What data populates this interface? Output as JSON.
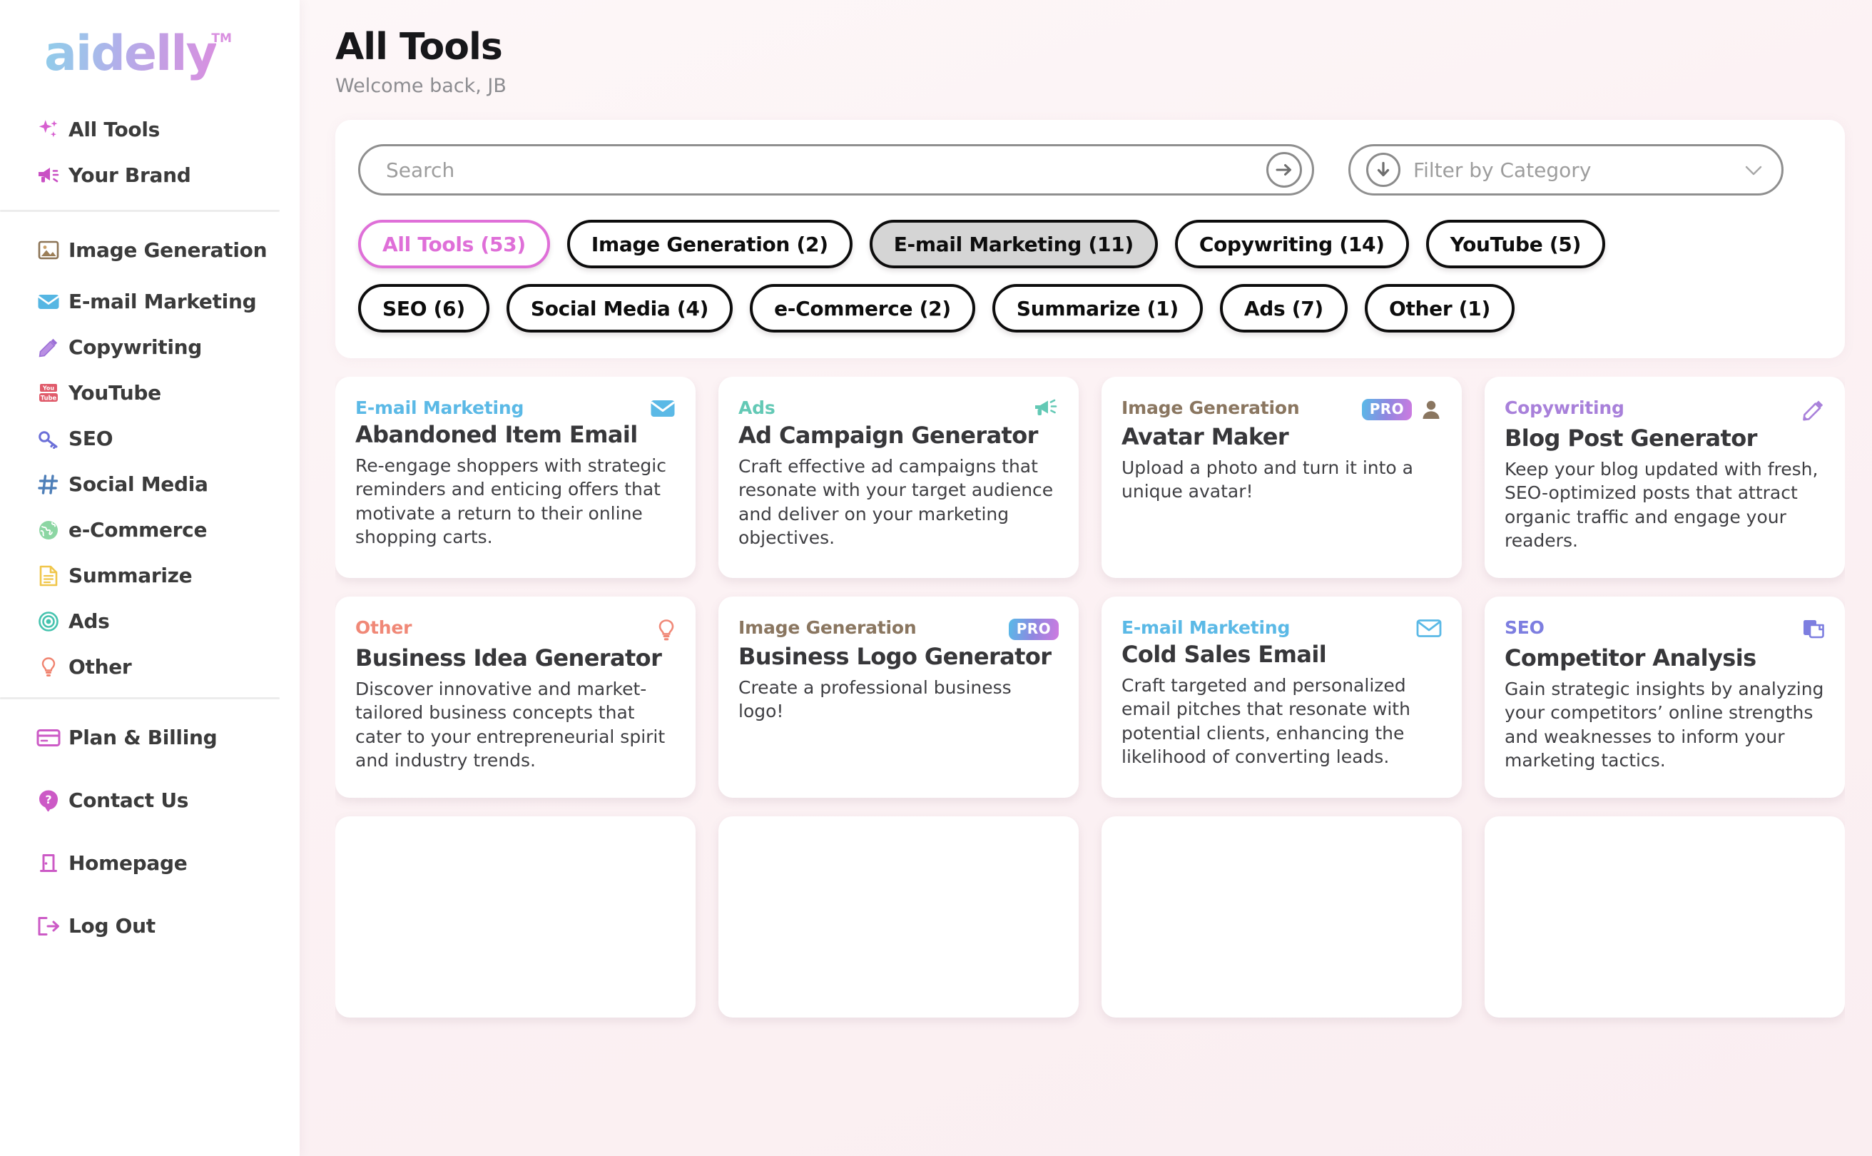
{
  "brand": {
    "name": "aidelly",
    "tm": "TM"
  },
  "sidebar": {
    "primary": [
      {
        "label": "All Tools",
        "icon": "sparkles-icon"
      },
      {
        "label": "Your Brand",
        "icon": "megaphone-icon"
      }
    ],
    "categories": [
      {
        "label": "Image Generation",
        "icon": "picture-icon"
      },
      {
        "label": "E-mail Marketing",
        "icon": "envelope-icon"
      },
      {
        "label": "Copywriting",
        "icon": "pencil-icon"
      },
      {
        "label": "YouTube",
        "icon": "youtube-icon"
      },
      {
        "label": "SEO",
        "icon": "key-icon"
      },
      {
        "label": "Social Media",
        "icon": "hash-icon"
      },
      {
        "label": "e-Commerce",
        "icon": "globe-icon"
      },
      {
        "label": "Summarize",
        "icon": "document-icon"
      },
      {
        "label": "Ads",
        "icon": "target-icon"
      },
      {
        "label": "Other",
        "icon": "lightbulb-icon"
      }
    ],
    "account": [
      {
        "label": "Plan & Billing",
        "icon": "credit-card-icon"
      },
      {
        "label": "Contact Us",
        "icon": "question-mark-icon"
      },
      {
        "label": "Homepage",
        "icon": "door-icon"
      },
      {
        "label": "Log Out",
        "icon": "logout-icon"
      }
    ]
  },
  "header": {
    "title": "All Tools",
    "subtitle": "Welcome back, JB"
  },
  "search": {
    "placeholder": "Search",
    "value": "",
    "submit_icon": "arrow-right-circle-icon"
  },
  "category_filter": {
    "placeholder": "Filter by Category",
    "selected": "Filter by Category",
    "icon": "arrow-down-circle-icon",
    "chevron": "⌄",
    "options": [
      "Filter by Category",
      "Image Generation",
      "E-mail Marketing",
      "Copywriting",
      "YouTube",
      "SEO",
      "Social Media",
      "e-Commerce",
      "Summarize",
      "Ads",
      "Other"
    ]
  },
  "pills": {
    "row1": [
      {
        "label": "All Tools (53)",
        "state": "active"
      },
      {
        "label": "Image Generation (2)",
        "state": "default"
      },
      {
        "label": "E-mail Marketing (11)",
        "state": "hovered"
      },
      {
        "label": "Copywriting (14)",
        "state": "default"
      },
      {
        "label": "YouTube (5)",
        "state": "default"
      }
    ],
    "row2": [
      {
        "label": "SEO (6)",
        "state": "default"
      },
      {
        "label": "Social Media (4)",
        "state": "default"
      },
      {
        "label": "e-Commerce (2)",
        "state": "default"
      },
      {
        "label": "Summarize (1)",
        "state": "default"
      },
      {
        "label": "Ads (7)",
        "state": "default"
      },
      {
        "label": "Other (1)",
        "state": "default"
      }
    ]
  },
  "colors": {
    "accent_pink": "#df6fd8",
    "email_blue": "#5bb9e6",
    "ads_teal": "#63c9b5",
    "image_brown": "#8a7660",
    "copywriting_purple": "#a880da",
    "other_salmon": "#f08877",
    "seo_indigo": "#7d7ee0",
    "background": "#faeef1"
  },
  "cards": [
    {
      "category": "E-mail Marketing",
      "category_color": "#5bb9e6",
      "icon": "envelope-filled-icon",
      "title": "Abandoned Item Email",
      "description": "Re-engage shoppers with strategic reminders and enticing offers that motivate a return to their online shopping carts.",
      "pro": false
    },
    {
      "category": "Ads",
      "category_color": "#63c9b5",
      "icon": "megaphone-icon",
      "title": "Ad Campaign Generator",
      "description": "Craft effective ad campaigns that resonate with your target audience and deliver on your marketing objectives.",
      "pro": false
    },
    {
      "category": "Image Generation",
      "category_color": "#8a7660",
      "icon": "person-icon",
      "title": "Avatar Maker",
      "description": "Upload a photo and turn it into a unique avatar!",
      "pro": true,
      "pro_label": "PRO"
    },
    {
      "category": "Copywriting",
      "category_color": "#a880da",
      "icon": "pencil-icon",
      "title": "Blog Post Generator",
      "description": "Keep your blog updated with fresh, SEO-optimized posts that attract organic traffic and engage your readers.",
      "pro": false
    },
    {
      "category": "Other",
      "category_color": "#f08877",
      "icon": "lightbulb-icon",
      "title": "Business Idea Generator",
      "description": "Discover innovative and market-tailored business concepts that cater to your entrepreneurial spirit and industry trends.",
      "pro": false
    },
    {
      "category": "Image Generation",
      "category_color": "#8a7660",
      "icon": "none",
      "title": "Business Logo Generator",
      "description": "Create a professional business logo!",
      "pro": true,
      "pro_label": "PRO"
    },
    {
      "category": "E-mail Marketing",
      "category_color": "#5bb9e6",
      "icon": "envelope-outline-icon",
      "title": "Cold Sales Email",
      "description": "Craft targeted and personalized email pitches that resonate with potential clients, enhancing the likelihood of converting leads.",
      "pro": false
    },
    {
      "category": "SEO",
      "category_color": "#7d7ee0",
      "icon": "copy-documents-icon",
      "title": "Competitor Analysis",
      "description": "Gain strategic insights by analyzing your competitors’ online strengths and weaknesses to inform your marketing tactics.",
      "pro": false
    },
    {
      "category": "",
      "category_color": "#ffffff",
      "icon": "none",
      "title": "",
      "description": "",
      "pro": false
    },
    {
      "category": "",
      "category_color": "#ffffff",
      "icon": "none",
      "title": "",
      "description": "",
      "pro": false
    },
    {
      "category": "",
      "category_color": "#ffffff",
      "icon": "none",
      "title": "",
      "description": "",
      "pro": false
    },
    {
      "category": "",
      "category_color": "#ffffff",
      "icon": "none",
      "title": "",
      "description": "",
      "pro": false
    }
  ]
}
